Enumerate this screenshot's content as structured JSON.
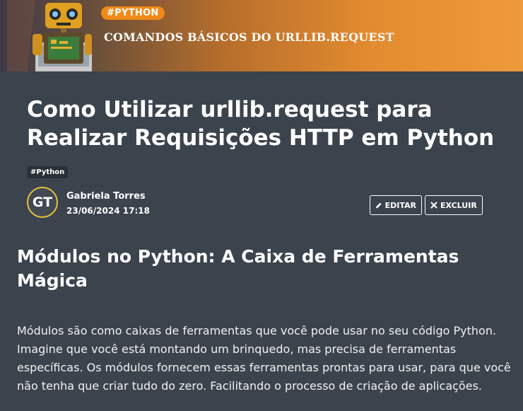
{
  "banner": {
    "tag": "#PYTHON",
    "title": "COMANDOS BÁSICOS DO URLLIB.REQUEST"
  },
  "article": {
    "title": "Como Utilizar urllib.request para Realizar Requisições HTTP em Python",
    "tag": "#Python"
  },
  "author": {
    "initials": "GT",
    "name": "Gabriela Torres",
    "date": "23/06/2024 17:18"
  },
  "actions": {
    "edit_label": "EDITAR",
    "delete_label": "EXCLUIR",
    "edit_icon": "pencil-icon",
    "delete_icon": "x-icon"
  },
  "content": {
    "heading": "Módulos no Python: A Caixa de Ferramentas Mágica",
    "paragraph": "Módulos são como caixas de ferramentas que você pode usar no seu código Python. Imagine que você está montando um brinquedo, mas precisa de ferramentas específicas. Os módulos fornecem essas ferramentas prontas para usar, para que você não tenha que criar tudo do zero. Facilitando o processo de criação de aplicações."
  },
  "colors": {
    "background": "#3b434d",
    "banner_accent": "#f08a1a",
    "avatar_ring": "#e8c33a"
  }
}
